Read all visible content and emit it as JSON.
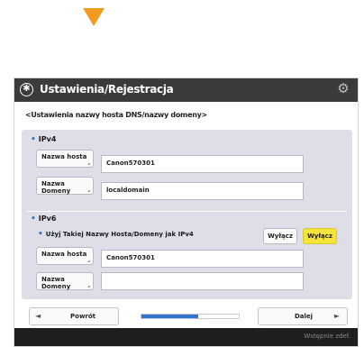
{
  "window": {
    "title": "Ustawienia/Rejestracja",
    "breadcrumb": "<Ustawienia nazwy hosta DNS/nazwy domeny>"
  },
  "ipv4": {
    "section_label": "IPv4",
    "host_name_label": "Nazwa hosta",
    "host_name_value": "Canon570301",
    "domain_name_label": "Nazwa Domeny",
    "domain_name_value": "localdomain"
  },
  "ipv6": {
    "section_label": "IPv6",
    "same_as_ipv4_label": "Użyj Takiej Nazwy Hosta/Domeny jak IPv4",
    "toggle_off_label": "Wyłącz",
    "toggle_on_label": "Wyłącz",
    "host_name_label": "Nazwa hosta",
    "host_name_value": "Canon570301",
    "domain_name_label": "Nazwa Domeny",
    "domain_name_value": ""
  },
  "navigation": {
    "back_label": "Powrót",
    "next_label": "Dalej",
    "progress_fraction": 0.58
  },
  "footer": {
    "text": "Wstępnie zdef."
  },
  "colors": {
    "arrow": "#f39a1f",
    "titlebar": "#3b3b3b",
    "content_bg": "#dedee8",
    "toggle_selected": "#f6e33c",
    "progress": "#2f74d0"
  }
}
